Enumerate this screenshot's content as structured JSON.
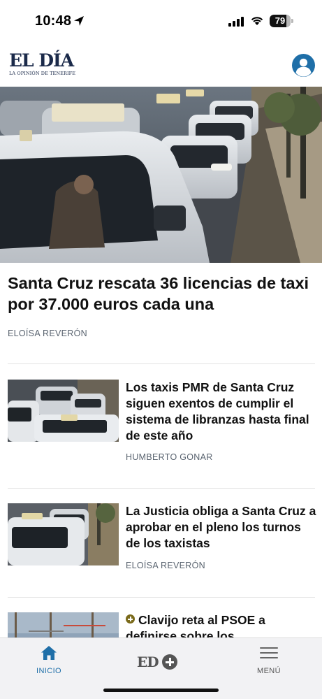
{
  "status": {
    "time": "10:48",
    "battery": "79",
    "battery_level": 0.79
  },
  "header": {
    "logo_main": "EL DÍA",
    "logo_sub": "LA OPINIÓN DE TENERIFE",
    "account_icon": "user-circle-icon"
  },
  "hero": {
    "title": "Santa Cruz rescata 36 licencias de taxi por 37.000 euros cada una",
    "author": "ELOÍSA REVERÓN"
  },
  "articles": [
    {
      "title": "Los taxis PMR de Santa Cruz siguen exentos de cumplir el sistema de libranzas hasta final de este año",
      "author": "HUMBERTO GONAR"
    },
    {
      "title": "La Justicia obliga a Santa Cruz a aprobar en el pleno los turnos de los taxistas",
      "author": "ELOÍSA REVERÓN"
    },
    {
      "title": "Clavijo reta al PSOE a definirse sobre los",
      "premium_icon": "plus-circle-icon"
    }
  ],
  "bottom_nav": {
    "home_label": "INICIO",
    "home_icon": "home-icon",
    "edplus_label": "ED",
    "menu_label": "MENÚ",
    "menu_icon": "hamburger-icon"
  },
  "colors": {
    "brand_navy": "#1b2a4a",
    "accent_blue": "#1f6fa8",
    "premium_gold": "#7a6a1a",
    "author_gray": "#5a6470"
  }
}
